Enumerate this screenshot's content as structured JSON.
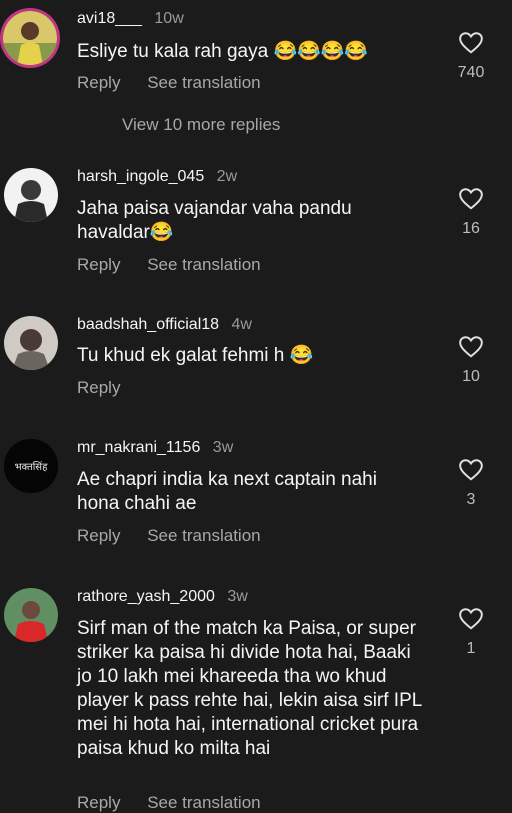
{
  "comments": [
    {
      "username": "avi18___",
      "time": "10w",
      "text": "Esliye tu kala rah gaya 😂😂😂😂",
      "reply": "Reply",
      "translate": "See translation",
      "likes": "740"
    },
    {
      "username": "harsh_ingole_045",
      "time": "2w",
      "text": "Jaha paisa vajandar vaha pandu havaldar😂",
      "reply": "Reply",
      "translate": "See translation",
      "likes": "16"
    },
    {
      "username": "baadshah_official18",
      "time": "4w",
      "text": "Tu khud ek galat fehmi h 😂",
      "reply": "Reply",
      "likes": "10"
    },
    {
      "username": "mr_nakrani_1156",
      "time": "3w",
      "text": "Ae chapri india ka next captain nahi hona chahi ae",
      "reply": "Reply",
      "translate": "See translation",
      "likes": "3",
      "avatar_text": "भक्तसिंह"
    },
    {
      "username": "rathore_yash_2000",
      "time": "3w",
      "text": "Sirf man of the match ka Paisa, or super striker ka paisa hi divide hota hai, Baaki jo 10 lakh mei khareeda tha wo khud player k pass rehte hai, lekin aisa sirf IPL mei hi hota hai, international cricket pura paisa khud ko milta hai",
      "reply": "Reply",
      "translate": "See translation",
      "likes": "1"
    }
  ],
  "view_more_replies": "View 10 more replies",
  "colors": {
    "background": "#1b1b1b",
    "text": "#f5f5f5",
    "muted": "#a8a8a8",
    "story_ring": "#c13584"
  }
}
